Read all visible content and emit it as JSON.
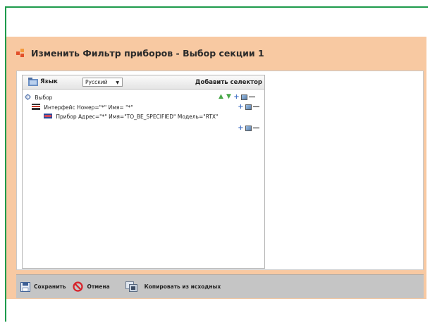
{
  "dialog": {
    "title": "Изменить Фильтр приборов - Выбор секции 1"
  },
  "tree_header": {
    "language_label": "Язык",
    "language_value": "Русский",
    "add_selector_label": "Добавить селектор"
  },
  "tree": {
    "root": {
      "label": "Выбор"
    },
    "interface": {
      "label": "Интерфейс Номер=\"*\" Имя= \"*\""
    },
    "device": {
      "label": "Прибор Адрес=\"*\" Имя=\"TO_BE_SPECIFIED\" Модель=\"RTX\""
    }
  },
  "buttons": {
    "save_label": "Сохранить",
    "cancel_label": "Отмена",
    "copy_label": "Копировать из исходных"
  },
  "colors": {
    "frame_accent": "#1e9b4c",
    "dialog_bg": "#f8c9a2",
    "bottom_bar_bg": "#c5c5c5"
  }
}
